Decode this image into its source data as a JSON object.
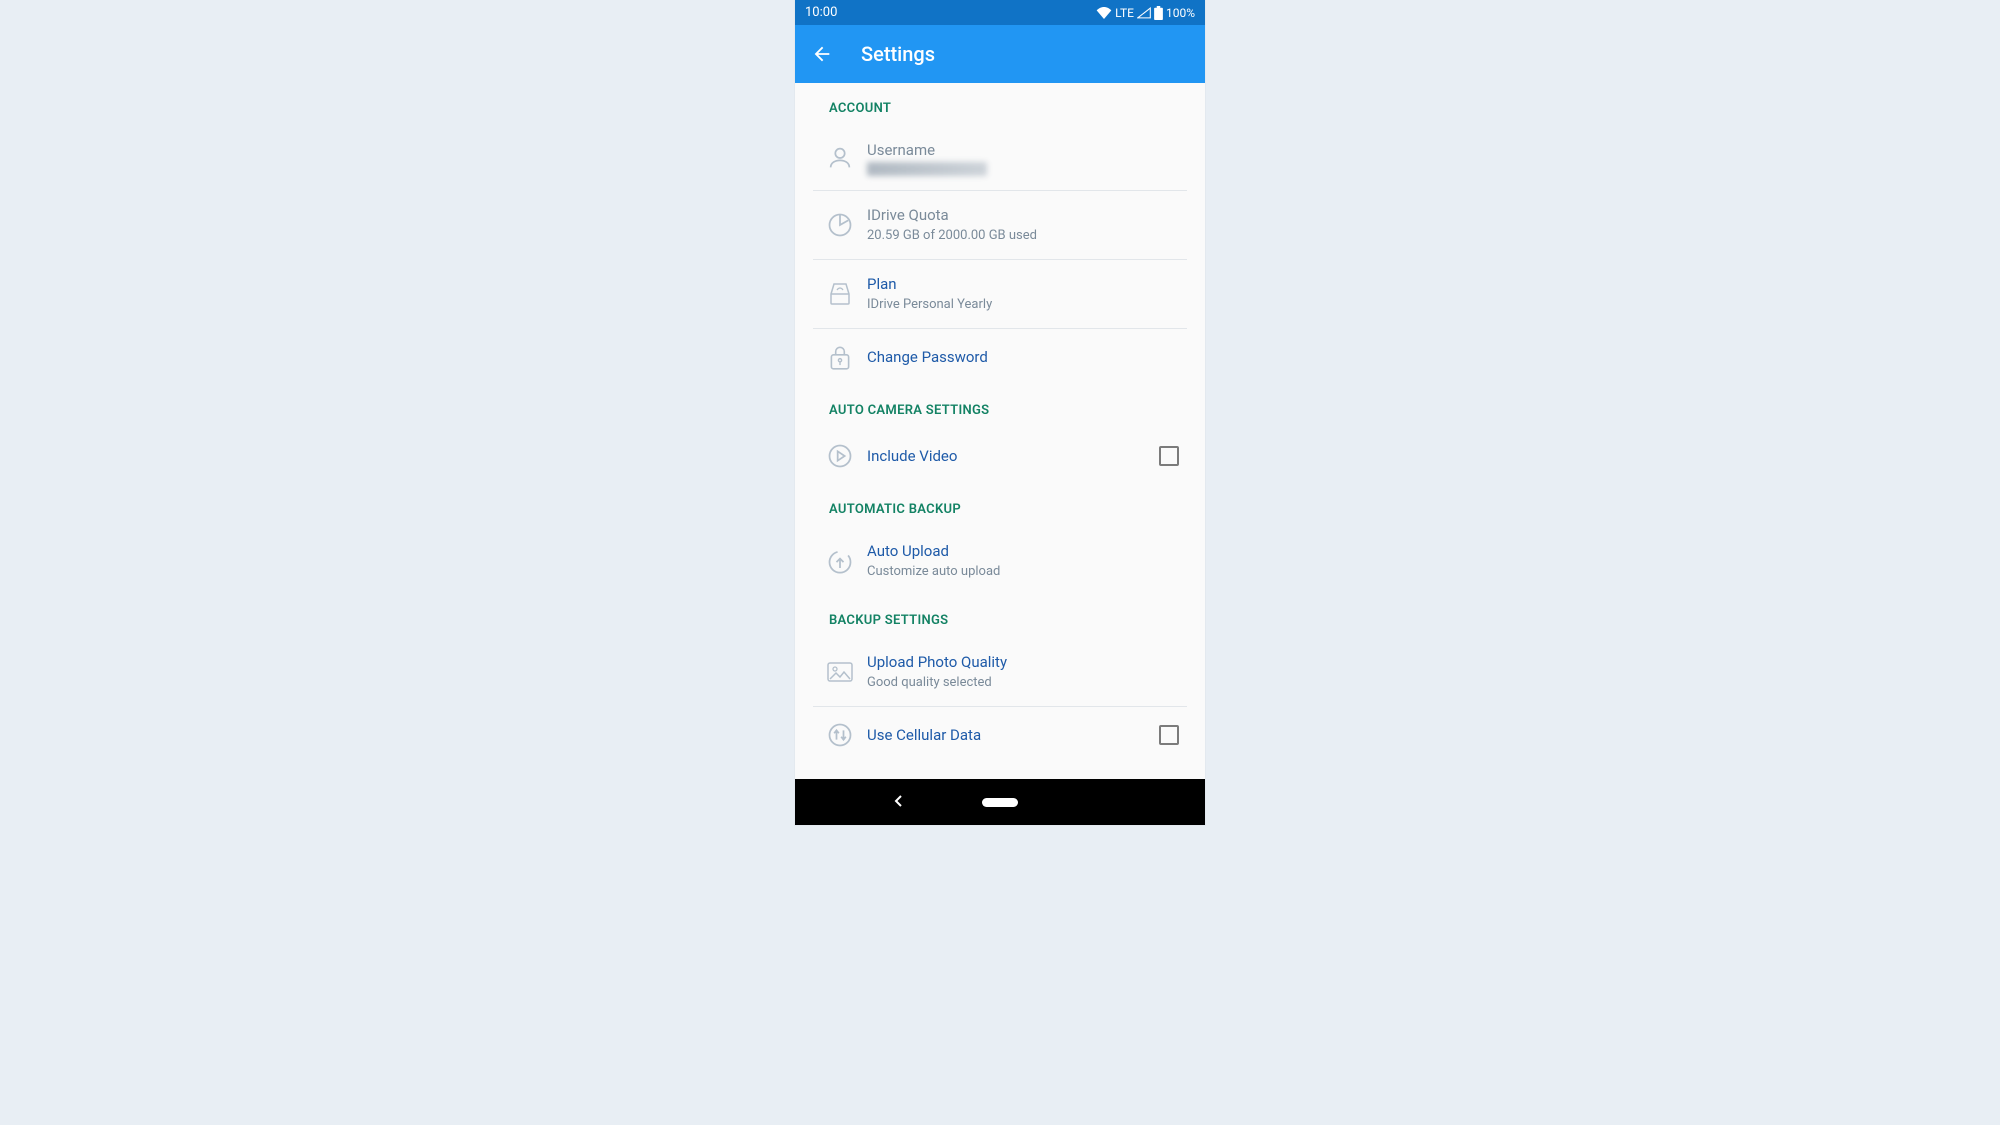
{
  "statusbar": {
    "time": "10:00",
    "lte": "LTE",
    "battery": "100%"
  },
  "appbar": {
    "title": "Settings"
  },
  "sections": {
    "account": {
      "title": "ACCOUNT",
      "username": {
        "label": "Username"
      },
      "quota": {
        "label": "IDrive Quota",
        "sub": "20.59 GB of 2000.00 GB used"
      },
      "plan": {
        "label": "Plan",
        "sub": "IDrive Personal Yearly"
      },
      "change_password": {
        "label": "Change Password"
      }
    },
    "auto_camera": {
      "title": "AUTO CAMERA SETTINGS",
      "include_video": {
        "label": "Include Video"
      }
    },
    "auto_backup": {
      "title": "AUTOMATIC BACKUP",
      "auto_upload": {
        "label": "Auto Upload",
        "sub": "Customize auto upload"
      }
    },
    "backup_settings": {
      "title": "BACKUP SETTINGS",
      "photo_quality": {
        "label": "Upload Photo Quality",
        "sub": "Good quality selected"
      },
      "cellular": {
        "label": "Use Cellular Data"
      }
    }
  }
}
